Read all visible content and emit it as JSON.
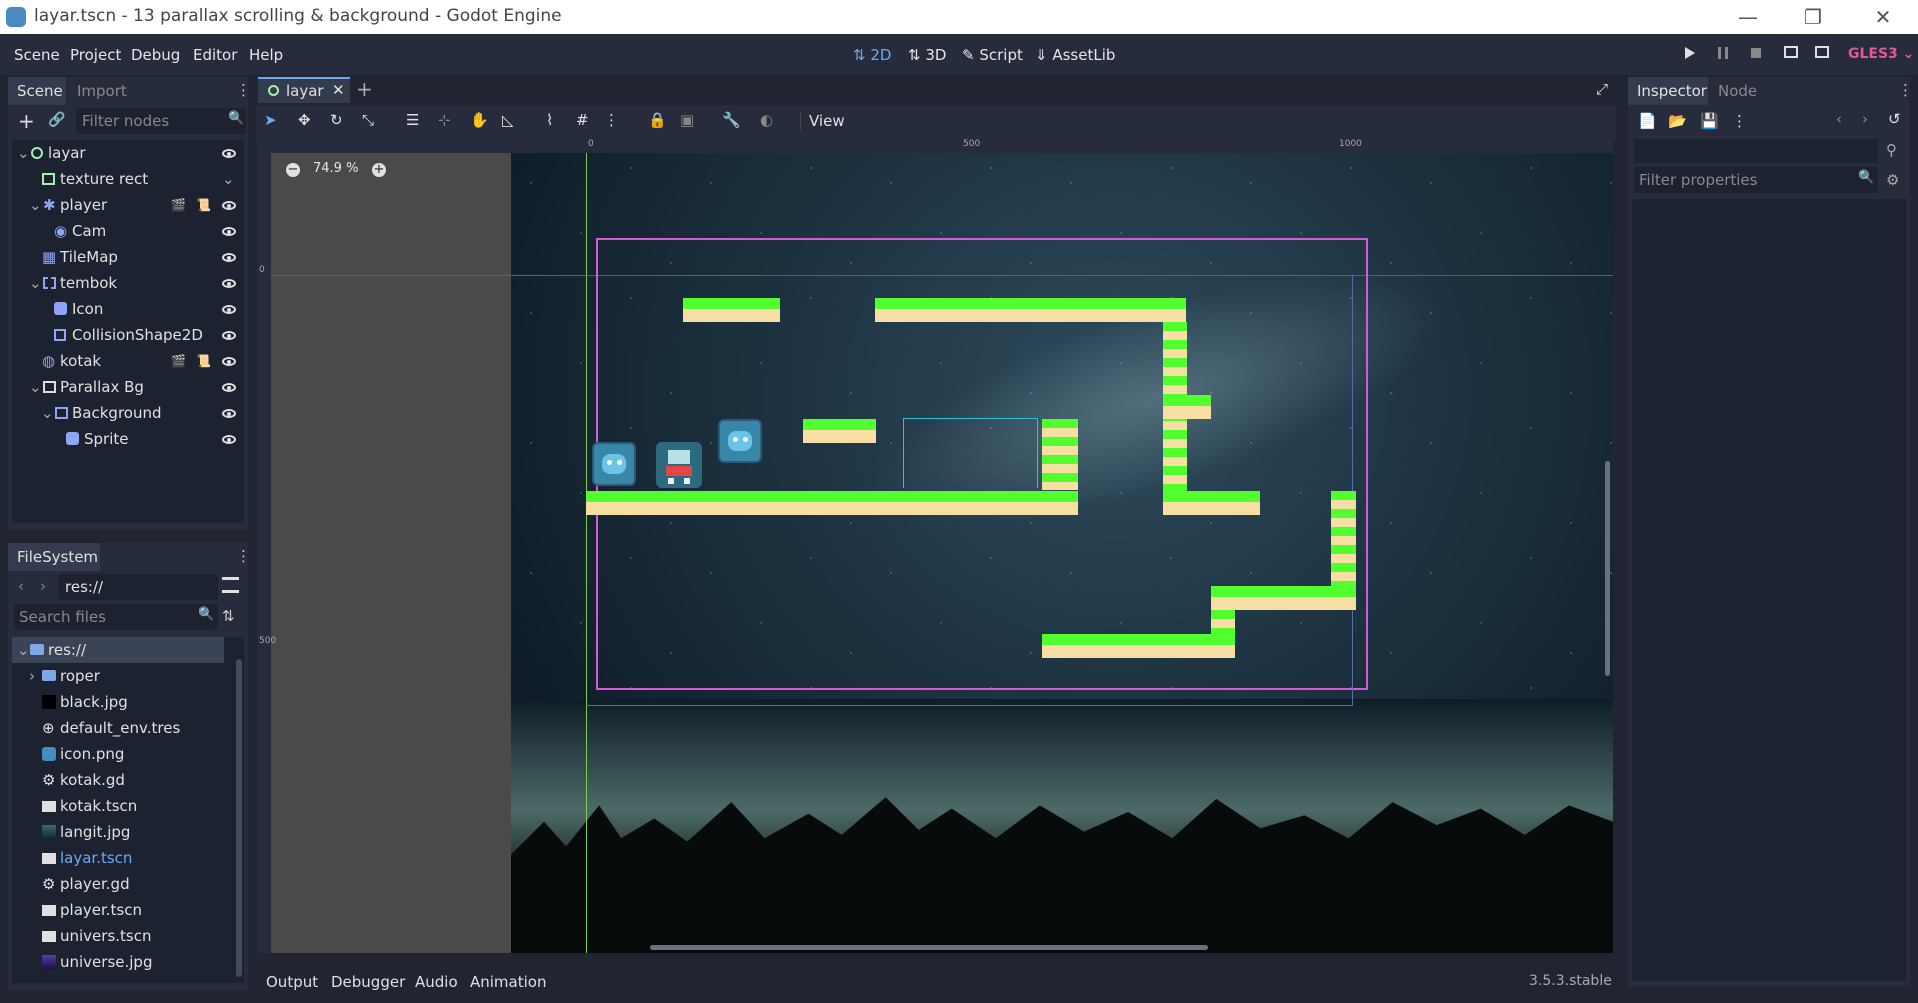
{
  "window": {
    "title": "layar.tscn - 13 parallax scrolling & background - Godot Engine"
  },
  "menu": [
    "Scene",
    "Project",
    "Debug",
    "Editor",
    "Help"
  ],
  "workspaces": {
    "2d": "2D",
    "3d": "3D",
    "script": "Script",
    "assetlib": "AssetLib"
  },
  "renderer": "GLES3",
  "scene_dock": {
    "tabs": [
      "Scene",
      "Import"
    ],
    "filter_placeholder": "Filter nodes",
    "nodes": [
      {
        "label": "layar"
      },
      {
        "label": "texture rect"
      },
      {
        "label": "player"
      },
      {
        "label": "Cam"
      },
      {
        "label": "TileMap"
      },
      {
        "label": "tembok"
      },
      {
        "label": "Icon"
      },
      {
        "label": "CollisionShape2D"
      },
      {
        "label": "kotak"
      },
      {
        "label": "Parallax Bg"
      },
      {
        "label": "Background"
      },
      {
        "label": "Sprite"
      }
    ]
  },
  "filesystem": {
    "title": "FileSystem",
    "path": "res://",
    "search_placeholder": "Search files",
    "items": [
      {
        "label": "res://"
      },
      {
        "label": "roper"
      },
      {
        "label": "black.jpg"
      },
      {
        "label": "default_env.tres"
      },
      {
        "label": "icon.png"
      },
      {
        "label": "kotak.gd"
      },
      {
        "label": "kotak.tscn"
      },
      {
        "label": "langit.jpg"
      },
      {
        "label": "layar.tscn"
      },
      {
        "label": "player.gd"
      },
      {
        "label": "player.tscn"
      },
      {
        "label": "univers.tscn"
      },
      {
        "label": "universe.jpg"
      }
    ]
  },
  "editor": {
    "tab": "layar",
    "view_menu": "View",
    "zoom": "74.9 %",
    "ruler": {
      "t0": "0",
      "t500": "500",
      "t1000": "1000",
      "v0": "0",
      "v500": "500"
    }
  },
  "inspector": {
    "tabs": [
      "Inspector",
      "Node"
    ],
    "filter_placeholder": "Filter properties"
  },
  "bottom": {
    "tabs": [
      "Output",
      "Debugger",
      "Audio",
      "Animation"
    ],
    "version": "3.5.3.stable"
  },
  "colors": {
    "accent": "#6fa8f0",
    "renderer": "#e0599a",
    "platform_green": "#52ff2e",
    "platform_cream": "#f7dfa4",
    "camera_rect": "#d65ad6"
  }
}
